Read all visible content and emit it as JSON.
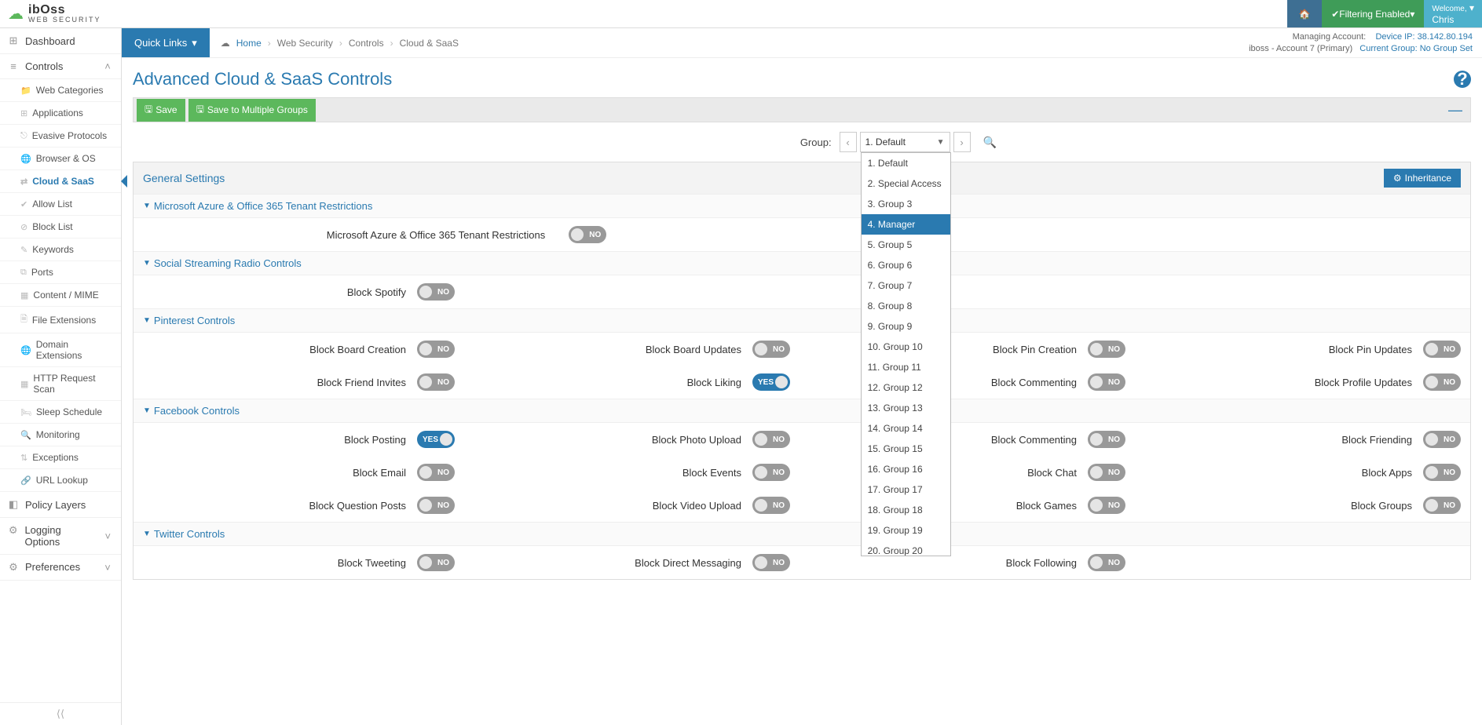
{
  "brand": {
    "line1": "ibOss",
    "line2": "WEB SECURITY"
  },
  "top": {
    "filtering": "Filtering Enabled",
    "welcome": "Welcome,",
    "user": "Chris"
  },
  "quicklinks": "Quick Links",
  "breadcrumbs": {
    "home": "Home",
    "l1": "Web Security",
    "l2": "Controls",
    "l3": "Cloud & SaaS"
  },
  "account": {
    "man_lbl": "Managing Account:",
    "man_val": "iboss - Account 7 (Primary)",
    "ip_lbl": "Device IP:",
    "ip_val": "38.142.80.194",
    "grp_lbl": "Current Group:",
    "grp_val": "No Group Set"
  },
  "sidebar": {
    "dashboard": "Dashboard",
    "controls": "Controls",
    "items": [
      "Web Categories",
      "Applications",
      "Evasive Protocols",
      "Browser & OS",
      "Cloud & SaaS",
      "Allow List",
      "Block List",
      "Keywords",
      "Ports",
      "Content / MIME",
      "File Extensions",
      "Domain Extensions",
      "HTTP Request Scan",
      "Sleep Schedule",
      "Monitoring",
      "Exceptions",
      "URL Lookup"
    ],
    "policy": "Policy Layers",
    "logging": "Logging Options",
    "prefs": "Preferences"
  },
  "title": "Advanced Cloud & SaaS Controls",
  "buttons": {
    "save": "Save",
    "save_multi": "Save to Multiple Groups",
    "inheritance": "Inheritance"
  },
  "group": {
    "label": "Group:",
    "selected": "1. Default",
    "options": [
      "1. Default",
      "2. Special Access",
      "3. Group 3",
      "4. Manager",
      "5. Group 5",
      "6. Group 6",
      "7. Group 7",
      "8. Group 8",
      "9. Group 9",
      "10. Group 10",
      "11. Group 11",
      "12. Group 12",
      "13. Group 13",
      "14. Group 14",
      "15. Group 15",
      "16. Group 16",
      "17. Group 17",
      "18. Group 18",
      "19. Group 19",
      "20. Group 20"
    ],
    "highlight": 3
  },
  "sections": {
    "general": "General Settings",
    "azure": {
      "title": "Microsoft Azure & Office 365 Tenant Restrictions",
      "c1": "Microsoft Azure & Office 365 Tenant Restrictions"
    },
    "radio": {
      "title": "Social Streaming Radio Controls",
      "c1": "Block Spotify"
    },
    "pinterest": {
      "title": "Pinterest Controls",
      "c": [
        "Block Board Creation",
        "Block Board Updates",
        "Block Pin Creation",
        "Block Pin Updates",
        "Block Friend Invites",
        "Block Liking",
        "Block Commenting",
        "Block Profile Updates"
      ],
      "v": [
        false,
        false,
        false,
        false,
        false,
        true,
        false,
        false
      ]
    },
    "facebook": {
      "title": "Facebook Controls",
      "c": [
        "Block Posting",
        "Block Photo Upload",
        "Block Commenting",
        "Block Friending",
        "Block Email",
        "Block Events",
        "Block Chat",
        "Block Apps",
        "Block Question Posts",
        "Block Video Upload",
        "Block Games",
        "Block Groups"
      ],
      "v": [
        true,
        false,
        false,
        false,
        false,
        false,
        false,
        false,
        false,
        false,
        false,
        false
      ]
    },
    "twitter": {
      "title": "Twitter Controls",
      "c": [
        "Block Tweeting",
        "Block Direct Messaging",
        "Block Following"
      ],
      "v": [
        false,
        false,
        false
      ]
    }
  },
  "tog": {
    "yes": "YES",
    "no": "NO"
  }
}
